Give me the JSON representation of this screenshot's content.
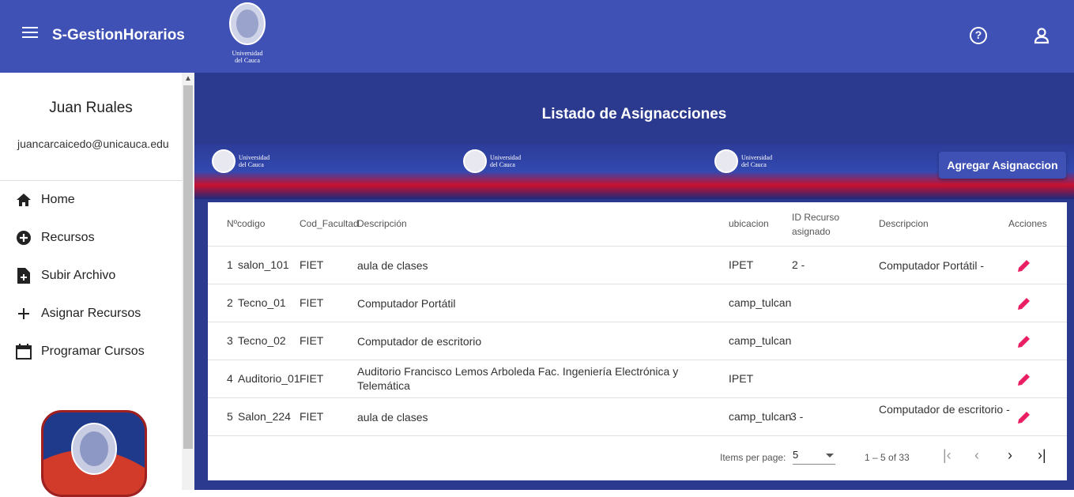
{
  "app": {
    "title": "S-GestionHorarios",
    "logo_text": [
      "Universidad",
      "del Cauca"
    ]
  },
  "user": {
    "name": "Juan Ruales",
    "email": "juancarcaicedo@unicauca.edu"
  },
  "nav": [
    {
      "label": "Home",
      "icon": "home-icon"
    },
    {
      "label": "Recursos",
      "icon": "add-circle-icon"
    },
    {
      "label": "Subir Archivo",
      "icon": "upload-file-icon"
    },
    {
      "label": "Asignar Recursos",
      "icon": "plus-icon"
    },
    {
      "label": "Programar Cursos",
      "icon": "calendar-icon"
    }
  ],
  "main": {
    "heading": "Listado de Asignacciones",
    "add_button": "Agregar Asignaccion",
    "banner_logo_text": [
      "Universidad",
      "del Cauca"
    ]
  },
  "table": {
    "columns": {
      "codigo": "Nºcodigo",
      "facultad": "Cod_Facultad",
      "descripcion": "Descripción",
      "ubicacion": "ubicacion",
      "recurso": [
        "ID Recurso",
        "asignado"
      ],
      "descripcion2": "Descripcion",
      "acciones": "Acciones"
    },
    "rows": [
      {
        "num": "1",
        "code": "salon_101",
        "fac": "FIET",
        "desc": "aula de clases",
        "ubic": "IPET",
        "rec": "2 -",
        "desc2": "Computador Portátil -"
      },
      {
        "num": "2",
        "code": "Tecno_01",
        "fac": "FIET",
        "desc": "Computador Portátil",
        "ubic": "camp_tulcan",
        "rec": "",
        "desc2": ""
      },
      {
        "num": "3",
        "code": "Tecno_02",
        "fac": "FIET",
        "desc": "Computador de escritorio",
        "ubic": "camp_tulcan",
        "rec": "",
        "desc2": ""
      },
      {
        "num": "4",
        "code": "Auditorio_01",
        "fac": "FIET",
        "desc": "Auditorio Francisco Lemos Arboleda Fac. Ingeniería Electrónica y Telemática",
        "ubic": "IPET",
        "rec": "",
        "desc2": ""
      },
      {
        "num": "5",
        "code": "Salon_224",
        "fac": "FIET",
        "desc": "aula de clases",
        "ubic": "camp_tulcan",
        "rec": "3 -",
        "desc2": "Computador de escritorio -"
      }
    ]
  },
  "paginator": {
    "items_per_page_label": "Items per page:",
    "page_size": "5",
    "range": "1 – 5 of 33"
  },
  "colors": {
    "primary": "#3f51b5",
    "edit_icon": "#e91e63",
    "banner_red": "#c8102e"
  }
}
